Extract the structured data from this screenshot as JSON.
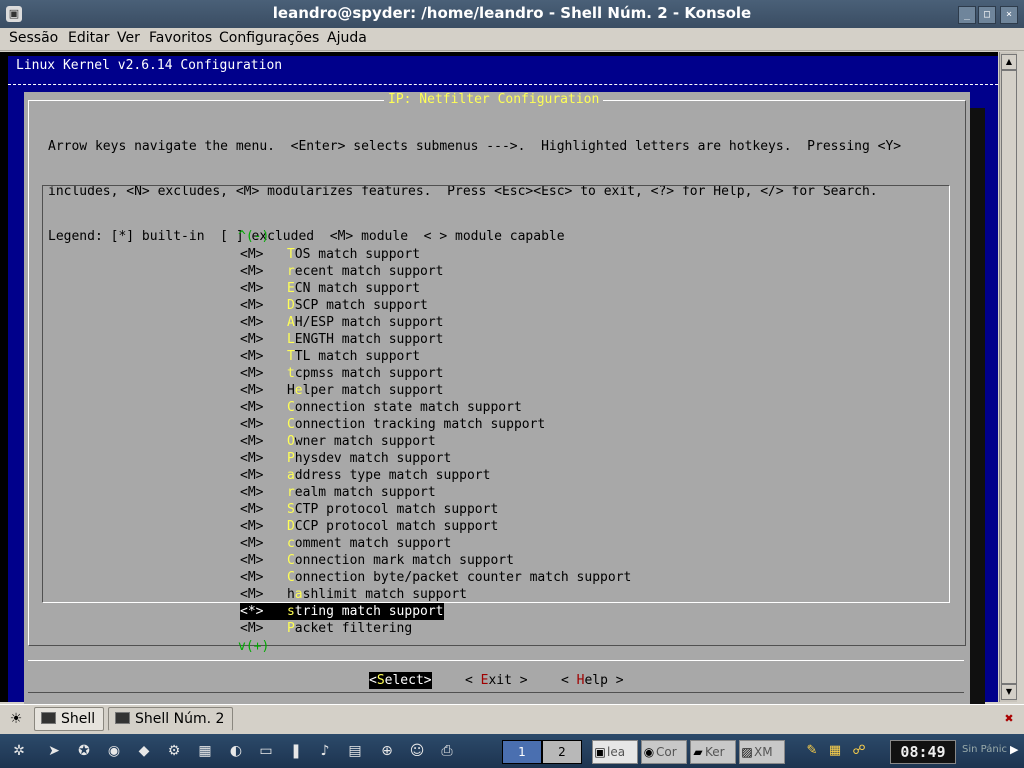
{
  "window": {
    "title": "leandro@spyder: /home/leandro - Shell Núm. 2 - Konsole",
    "icon": "konsole-icon",
    "controls": {
      "minimize": "_",
      "maximize": "□",
      "close": "×"
    }
  },
  "menubar": {
    "items": [
      "Sessão",
      "Editar",
      "Ver",
      "Favoritos",
      "Configurações",
      "Ajuda"
    ]
  },
  "terminal": {
    "kconfig_title": "Linux Kernel v2.6.14 Configuration",
    "dialog": {
      "title": "IP: Netfilter Configuration",
      "help_lines": [
        "Arrow keys navigate the menu.  <Enter> selects submenus --->.  Highlighted letters are hotkeys.  Pressing <Y>",
        "includes, <N> excludes, <M> modularizes features.  Press <Esc><Esc> to exit, <?> for Help, </> for Search.",
        "Legend: [*] built-in  [ ] excluded  <M> module  < > module capable"
      ],
      "scroll_up": "^(-)",
      "scroll_down": "v(+)",
      "items": [
        {
          "marker": "<M>",
          "hot": "T",
          "rest": "OS match support"
        },
        {
          "marker": "<M>",
          "hot": "r",
          "rest": "ecent match support"
        },
        {
          "marker": "<M>",
          "hot": "E",
          "rest": "CN match support"
        },
        {
          "marker": "<M>",
          "hot": "D",
          "rest": "SCP match support"
        },
        {
          "marker": "<M>",
          "hot": "A",
          "rest": "H/ESP match support"
        },
        {
          "marker": "<M>",
          "hot": "L",
          "rest": "ENGTH match support"
        },
        {
          "marker": "<M>",
          "hot": "T",
          "rest": "TL match support"
        },
        {
          "marker": "<M>",
          "hot": "t",
          "rest": "cpmss match support"
        },
        {
          "marker": "<M>",
          "pre": "H",
          "hot": "e",
          "rest": "lper match support"
        },
        {
          "marker": "<M>",
          "hot": "C",
          "rest": "onnection state match support"
        },
        {
          "marker": "<M>",
          "hot": "C",
          "rest": "onnection tracking match support"
        },
        {
          "marker": "<M>",
          "hot": "O",
          "rest": "wner match support"
        },
        {
          "marker": "<M>",
          "hot": "P",
          "rest": "hysdev match support"
        },
        {
          "marker": "<M>",
          "hot": "a",
          "rest": "ddress type match support"
        },
        {
          "marker": "<M>",
          "hot": "r",
          "rest": "ealm match support"
        },
        {
          "marker": "<M>",
          "hot": "S",
          "rest": "CTP protocol match support"
        },
        {
          "marker": "<M>",
          "hot": "D",
          "rest": "CCP protocol match support"
        },
        {
          "marker": "<M>",
          "hot": "c",
          "rest": "omment match support"
        },
        {
          "marker": "<M>",
          "hot": "C",
          "rest": "onnection mark match support"
        },
        {
          "marker": "<M>",
          "hot": "C",
          "rest": "onnection byte/packet counter match support"
        },
        {
          "marker": "<M>",
          "pre": "h",
          "hot": "a",
          "rest": "shlimit match support"
        },
        {
          "marker": "<*>",
          "hot": "s",
          "rest": "tring match support",
          "selected": true
        },
        {
          "marker": "<M>",
          "hot": "P",
          "rest": "acket filtering"
        }
      ],
      "buttons": [
        {
          "pre": "<",
          "hot": "S",
          "rest": "elect>",
          "selected": true
        },
        {
          "pre": "< ",
          "hot": "E",
          "rest": "xit >"
        },
        {
          "pre": "< ",
          "hot": "H",
          "rest": "elp >"
        }
      ]
    }
  },
  "tabs": [
    {
      "label": "Shell",
      "active": false
    },
    {
      "label": "Shell Núm. 2",
      "active": true
    }
  ],
  "panel": {
    "pager": [
      "1",
      "2"
    ],
    "tasks": [
      "lea",
      "Cor",
      "Ker",
      "XM"
    ],
    "clock": "08:49",
    "label": "Sin Pánic"
  },
  "colors": {
    "terminal_bg": "#00008b",
    "dialog_bg": "#a8a8a8",
    "hotkey": "#ffff55",
    "button_hotkey": "#a00000",
    "scroll_indicator": "#00aa00"
  }
}
